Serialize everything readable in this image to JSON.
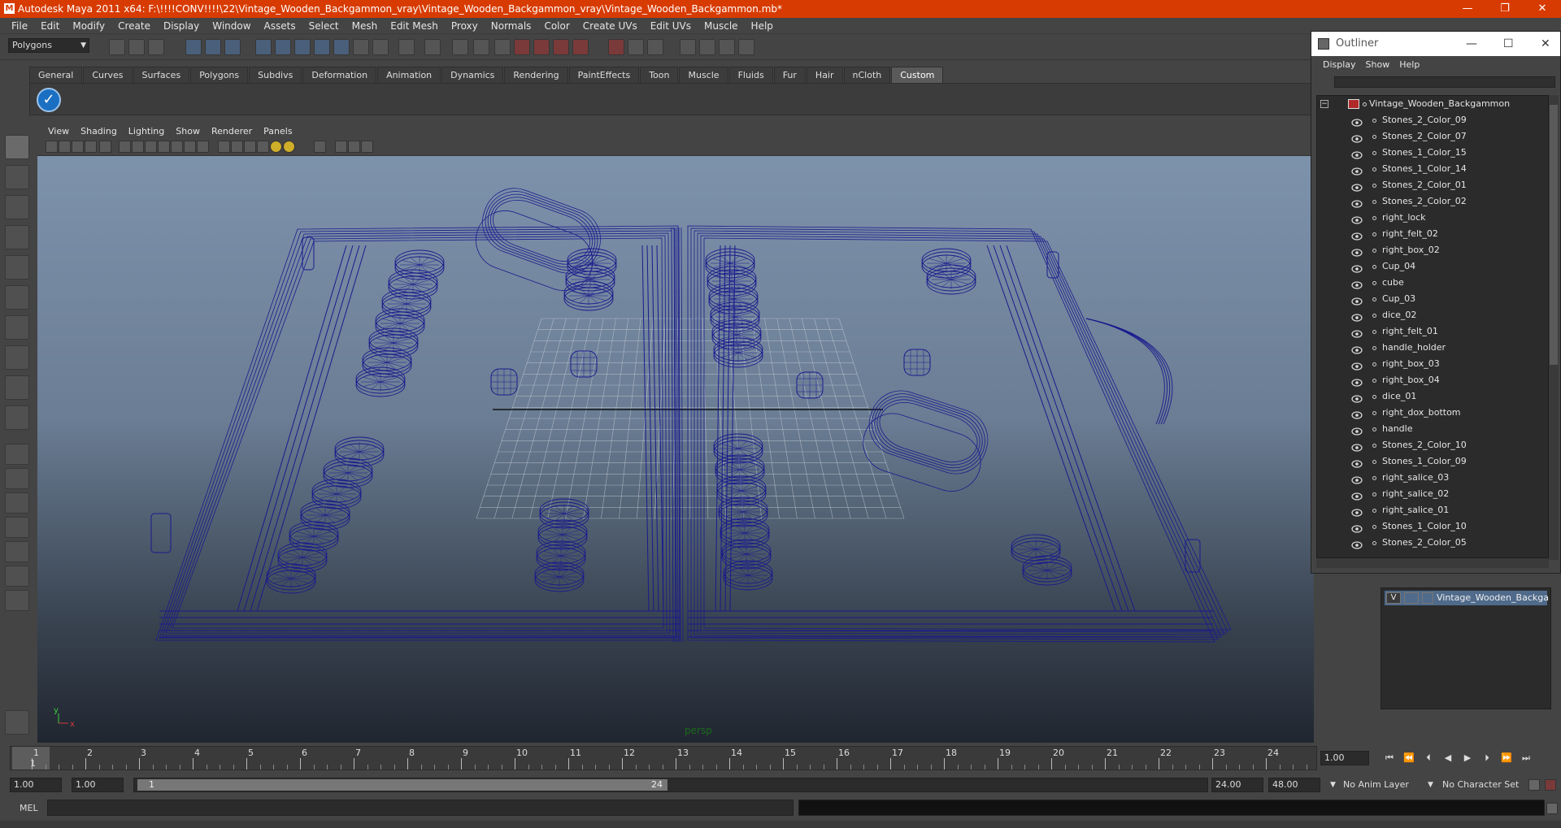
{
  "window": {
    "title": "Autodesk Maya 2011 x64: F:\\!!!!CONV!!!!\\22\\Vintage_Wooden_Backgammon_vray\\Vintage_Wooden_Backgammon_vray\\Vintage_Wooden_Backgammon.mb*",
    "minimize": "—",
    "maximize": "❐",
    "close": "✕"
  },
  "menubar": [
    "File",
    "Edit",
    "Modify",
    "Create",
    "Display",
    "Window",
    "Assets",
    "Select",
    "Mesh",
    "Edit Mesh",
    "Proxy",
    "Normals",
    "Color",
    "Create UVs",
    "Edit UVs",
    "Muscle",
    "Help"
  ],
  "statusline": {
    "mode": "Polygons"
  },
  "shelf": {
    "tabs": [
      "General",
      "Curves",
      "Surfaces",
      "Polygons",
      "Subdivs",
      "Deformation",
      "Animation",
      "Dynamics",
      "Rendering",
      "PaintEffects",
      "Toon",
      "Muscle",
      "Fluids",
      "Fur",
      "Hair",
      "nCloth",
      "Custom"
    ],
    "active_tab": "Custom"
  },
  "viewport": {
    "menu": [
      "View",
      "Shading",
      "Lighting",
      "Show",
      "Renderer",
      "Panels"
    ],
    "camera_label": "persp",
    "axis_y": "y",
    "axis_x": "x",
    "wire_color": "#1a1a8c"
  },
  "outliner": {
    "title": "Outliner",
    "menu": [
      "Display",
      "Show",
      "Help"
    ],
    "root": "Vintage_Wooden_Backgammon",
    "items": [
      "Stones_2_Color_09",
      "Stones_2_Color_07",
      "Stones_1_Color_15",
      "Stones_1_Color_14",
      "Stones_2_Color_01",
      "Stones_2_Color_02",
      "right_lock",
      "right_felt_02",
      "right_box_02",
      "Cup_04",
      "cube",
      "Cup_03",
      "dice_02",
      "right_felt_01",
      "handle_holder",
      "right_box_03",
      "right_box_04",
      "dice_01",
      "right_dox_bottom",
      "handle",
      "Stones_2_Color_10",
      "Stones_1_Color_09",
      "right_salice_03",
      "right_salice_02",
      "right_salice_01",
      "Stones_1_Color_10",
      "Stones_2_Color_05"
    ]
  },
  "layers": {
    "visible_flag": "V",
    "layer_name": "Vintage_Wooden_Backga"
  },
  "timeslider": {
    "ticks": [
      "1",
      "2",
      "3",
      "4",
      "5",
      "6",
      "7",
      "8",
      "9",
      "10",
      "11",
      "12",
      "13",
      "14",
      "15",
      "16",
      "17",
      "18",
      "19",
      "20",
      "21",
      "22",
      "23",
      "24"
    ],
    "current_frame": "1",
    "current_field": "1.00"
  },
  "rangeslider": {
    "start": "1.00",
    "playback_start": "1.00",
    "range_start_label": "1",
    "range_end_label": "24",
    "playback_end": "24.00",
    "end": "48.00",
    "anim_layer": "No Anim Layer",
    "character_set": "No Character Set"
  },
  "cmdline": {
    "label": "MEL"
  }
}
